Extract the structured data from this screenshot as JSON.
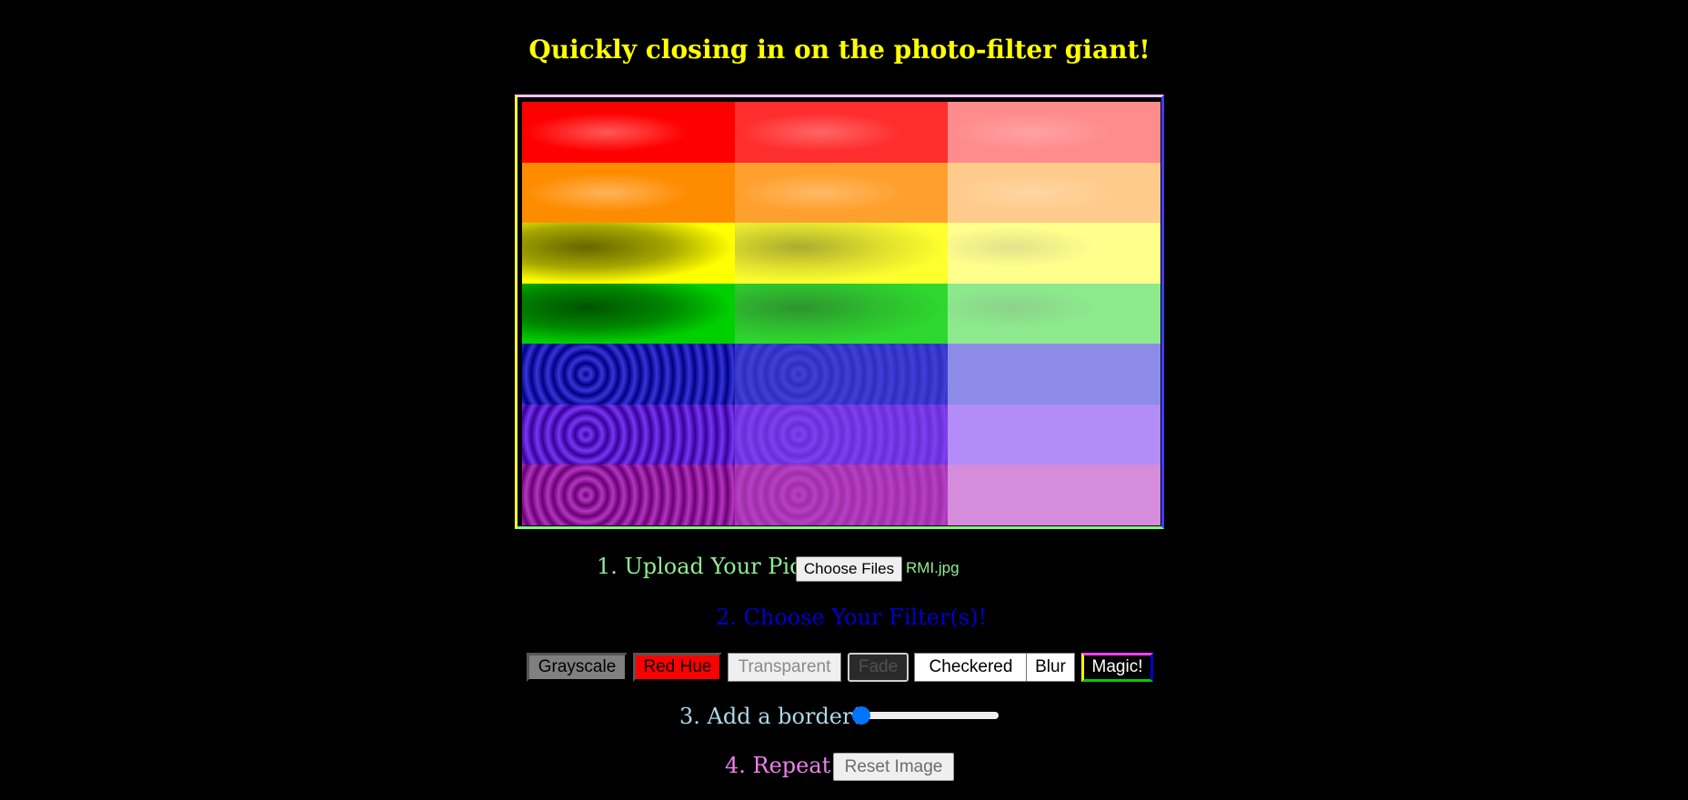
{
  "title": "Quickly closing in on the photo-filter giant!",
  "canvas": {
    "bands": [
      "#ff0000",
      "#ff8c00",
      "#ffff00",
      "#00d000",
      "#0000cc",
      "#5500ee",
      "#a000b0"
    ],
    "columns": 3
  },
  "steps": {
    "upload_label": "1. Upload Your Pic!",
    "upload_button": "Choose Files",
    "upload_filename": "RMI.jpg",
    "filter_label": "2. Choose Your Filter(s)!",
    "border_label": "3. Add a border!",
    "repeat_label": "4. Repeat!",
    "reset_button": "Reset Image"
  },
  "colors": {
    "title": "#ffff00",
    "upload": "#90ee90",
    "filter": "#0000cd",
    "border": "#add8e6",
    "repeat": "#ee82ee"
  },
  "filters": [
    {
      "key": "grayscale",
      "label": "Grayscale",
      "bg": "#808080",
      "fg": "#000000"
    },
    {
      "key": "red-hue",
      "label": "Red Hue",
      "bg": "#ff0000",
      "fg": "#000000"
    },
    {
      "key": "transparent",
      "label": "Transparent",
      "bg": "#efefef",
      "fg": "#8a8a8a"
    },
    {
      "key": "fade",
      "label": "Fade",
      "bg": "#2a2a2a",
      "fg": "#505050"
    },
    {
      "key": "checkered",
      "label": "Checkered",
      "bg": "#ffffff",
      "fg": "#000000"
    },
    {
      "key": "blur",
      "label": "Blur",
      "bg": "#ffffff",
      "fg": "#000000"
    },
    {
      "key": "magic",
      "label": "Magic!",
      "bg": "#000000",
      "fg": "#ffffff"
    }
  ],
  "border_slider": {
    "value": 0
  }
}
